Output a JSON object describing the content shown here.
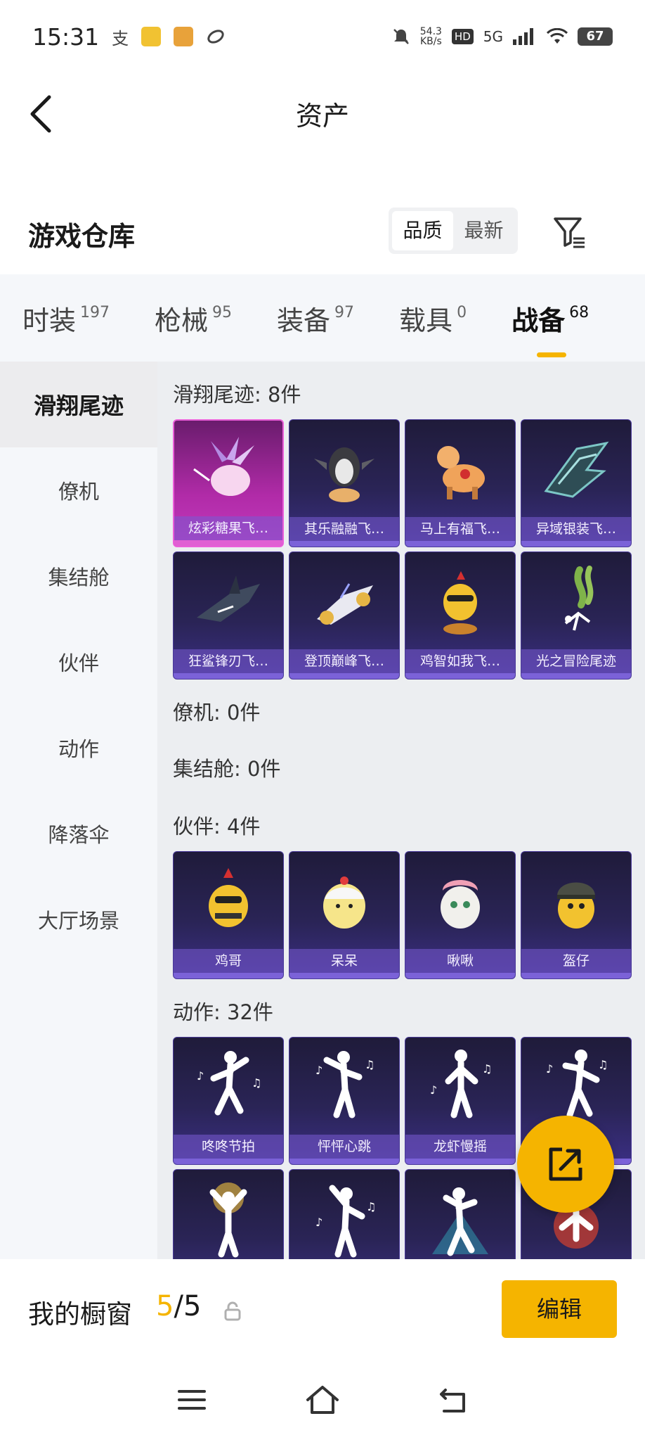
{
  "status": {
    "time": "15:31",
    "pay_icon_text": "支",
    "net_speed_value": "54.3",
    "net_speed_unit": "KB/s",
    "hd_label": "HD",
    "network": "5G",
    "battery": "67"
  },
  "header": {
    "title": "资产"
  },
  "warehouse": {
    "title": "游戏仓库",
    "sort_options": [
      "品质",
      "最新"
    ]
  },
  "tabs": [
    {
      "label": "时装",
      "count": "197"
    },
    {
      "label": "枪械",
      "count": "95"
    },
    {
      "label": "装备",
      "count": "97"
    },
    {
      "label": "载具",
      "count": "0"
    },
    {
      "label": "战备",
      "count": "68"
    }
  ],
  "sidebar": {
    "items": [
      "滑翔尾迹",
      "僚机",
      "集结舱",
      "伙伴",
      "动作",
      "降落伞",
      "大厅场景"
    ]
  },
  "sections": {
    "glide": {
      "heading": "滑翔尾迹: 8件",
      "items": [
        "炫彩糖果飞…",
        "其乐融融飞…",
        "马上有福飞…",
        "异域银装飞…",
        "狂鲨锋刃飞…",
        "登顶巅峰飞…",
        "鸡智如我飞…",
        "光之冒险尾迹"
      ]
    },
    "wingman": {
      "heading": "僚机: 0件"
    },
    "assembly": {
      "heading": "集结舱: 0件"
    },
    "partner": {
      "heading": "伙伴: 4件",
      "items": [
        "鸡哥",
        "呆呆",
        "啾啾",
        "盔仔"
      ]
    },
    "emote": {
      "heading": "动作: 32件",
      "items": [
        "咚咚节拍",
        "怦怦心跳",
        "龙虾慢摇"
      ]
    }
  },
  "showcase": {
    "title": "我的橱窗",
    "current": "5",
    "sep": "/",
    "max": "5",
    "edit_label": "编辑"
  },
  "colors": {
    "accent": "#f5b400",
    "card_purple": "#2a2456",
    "card_selected": "#b12ba8"
  }
}
